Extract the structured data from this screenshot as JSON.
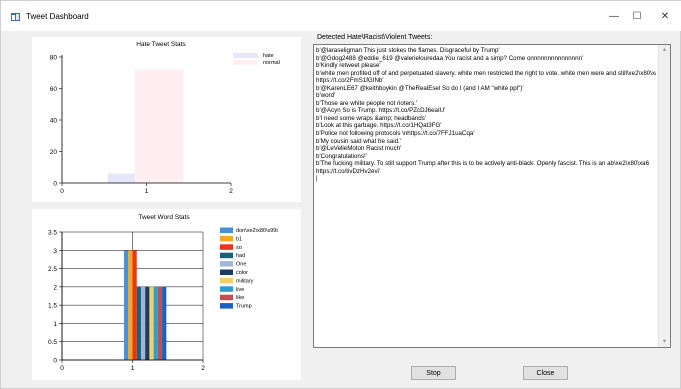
{
  "window": {
    "title": "Tweet Dashboard"
  },
  "titlebar_buttons": {
    "minimize": "—",
    "maximize": "☐",
    "close": "✕"
  },
  "charts": [
    {
      "type": "bar",
      "title": "Hate Tweet Stats",
      "xlim": [
        0,
        2
      ],
      "ylim": [
        0,
        80
      ],
      "xticks": [
        "0",
        "1",
        "2"
      ],
      "yticks": [
        "0",
        "20",
        "40",
        "60",
        "80"
      ],
      "grid": false,
      "legend_placement": "top-right",
      "series": [
        {
          "name": "hate",
          "color": "#e6e6fa",
          "x": 0.83,
          "width": 0.58,
          "value": 6
        },
        {
          "name": "normal",
          "color": "#ffeef2",
          "x": 1.15,
          "width": 0.58,
          "value": 72
        }
      ]
    },
    {
      "type": "bar",
      "title": "Tweet Word Stats",
      "xlim": [
        0,
        2
      ],
      "ylim": [
        0,
        3.5
      ],
      "xticks": [
        "0",
        "1",
        "2"
      ],
      "yticks": [
        "0",
        "0.5",
        "1",
        "1.5",
        "2",
        "2.5",
        "3",
        "3.5"
      ],
      "grid": true,
      "legend_placement": "top-right",
      "categories": [
        "don\\xe2\\x80\\x99t",
        "b1",
        "so",
        "had",
        "One",
        "color",
        "military",
        "live",
        "like",
        "Trump"
      ],
      "values": [
        3,
        3,
        3,
        2,
        2,
        2,
        2,
        2,
        2,
        2
      ],
      "colors": [
        "#4a90d9",
        "#f5a623",
        "#e8341c",
        "#1f5f7a",
        "#9eb7d4",
        "#1f3a5f",
        "#f2d06b",
        "#2e9bd6",
        "#c0504d",
        "#1a5ec7"
      ]
    }
  ],
  "tweets_group": {
    "label": "Detected Hate\\Racist\\Violent Tweets:",
    "lines": [
      "b'@laraseligman This just stokes the flames. Disgraceful by Trump'",
      "b'@Gdog2488 @eddie_619 @valerielouredaa You racist and a simp? Come onnnnnnnnnnnnnnn'",
      "b'Kindly retweet please'",
      "b'white men profited off of and perpetuated slavery. white men restricted the right to vote. white men were and still\\xe2\\x80\\xa6",
      "https://t.co/2FmS1fGINb'",
      "b'@KarenLE67 @keithboykin @TheRealEsel So do I (and I AM \"white ppl\")'",
      "b'word'",
      "b'Those are white people not rioters.'",
      "b'@Acyn So is Trump. https://t.co/PZcDJ6eaIU'",
      "b'I need some wraps &amp; headbands'",
      "b'Look at this garbage. https://t.co/1HQat3FG'",
      "b'Police not following protocols \\nhttps://t.co/7FFJ1uaCqa'",
      "b'My cousin said what he said.'",
      "b'@LeVelleMoton Racist much'",
      "b'Congratulations!'",
      "b'The fucking military. To still support Trump after this is to be actively anti-black. Openly fascist. This is an ab\\xe2\\x80\\xa6",
      "https://t.co/tivDzHv2evi'",
      "|"
    ]
  },
  "buttons": {
    "stop": "Stop",
    "close": "Close"
  }
}
